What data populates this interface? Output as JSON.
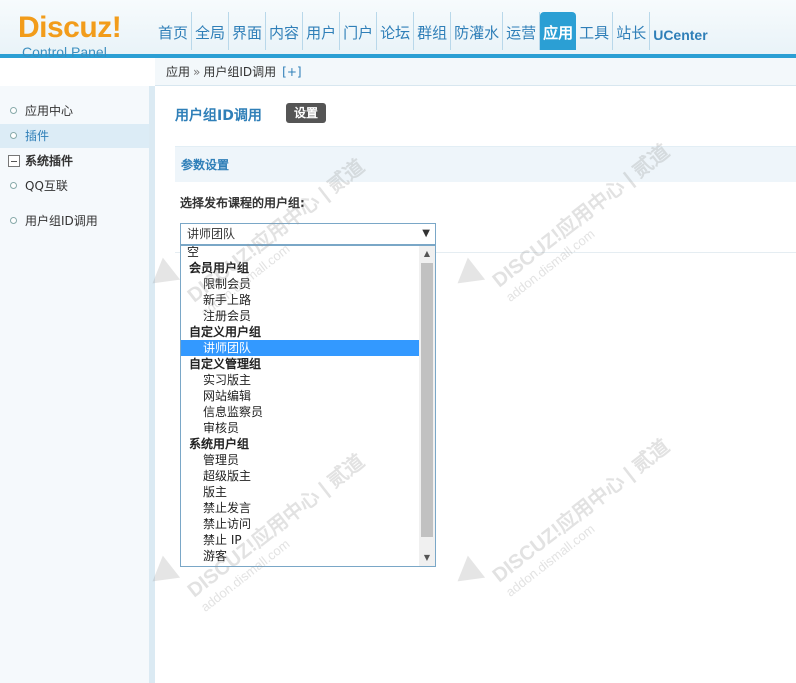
{
  "header": {
    "logo_brand": "Discuz",
    "logo_exclaim": "!",
    "logo_sub": "Control Panel",
    "nav": [
      "首页",
      "全局",
      "界面",
      "内容",
      "用户",
      "门户",
      "论坛",
      "群组",
      "防灌水",
      "运营",
      "应用",
      "工具",
      "站长",
      "UCenter"
    ],
    "active_nav": "应用"
  },
  "breadcrumb": {
    "root": "应用",
    "separator": "»",
    "current": "用户组ID调用",
    "add": "[+]"
  },
  "sidebar": {
    "items": [
      "应用中心",
      "插件"
    ],
    "selected": "插件",
    "section_title": "系统插件",
    "section_items": [
      "QQ互联",
      "用户组ID调用"
    ]
  },
  "main": {
    "title": "用户组ID调用",
    "settings_button": "设置",
    "section_title": "参数设置",
    "field_label": "选择发布课程的用户组:"
  },
  "select": {
    "value": "讲师团队",
    "options": [
      {
        "label": "空",
        "kind": "plain"
      },
      {
        "label": "会员用户组",
        "kind": "group"
      },
      {
        "label": "限制会员",
        "kind": "sub"
      },
      {
        "label": "新手上路",
        "kind": "sub"
      },
      {
        "label": "注册会员",
        "kind": "sub"
      },
      {
        "label": "自定义用户组",
        "kind": "group"
      },
      {
        "label": "讲师团队",
        "kind": "sub",
        "highlighted": true
      },
      {
        "label": "自定义管理组",
        "kind": "group"
      },
      {
        "label": "实习版主",
        "kind": "sub"
      },
      {
        "label": "网站编辑",
        "kind": "sub"
      },
      {
        "label": "信息监察员",
        "kind": "sub"
      },
      {
        "label": "审核员",
        "kind": "sub"
      },
      {
        "label": "系统用户组",
        "kind": "group"
      },
      {
        "label": "管理员",
        "kind": "sub"
      },
      {
        "label": "超级版主",
        "kind": "sub"
      },
      {
        "label": "版主",
        "kind": "sub"
      },
      {
        "label": "禁止发言",
        "kind": "sub"
      },
      {
        "label": "禁止访问",
        "kind": "sub"
      },
      {
        "label": "禁止 IP",
        "kind": "sub"
      },
      {
        "label": "游客",
        "kind": "sub"
      }
    ]
  },
  "watermark": {
    "line1": "DISCUZ!应用中心 | 贰道",
    "line2": "addon.dismall.com"
  },
  "colors": {
    "accent": "#2b9fd4",
    "brand_orange": "#f29c1b",
    "highlight": "#3399ff"
  }
}
